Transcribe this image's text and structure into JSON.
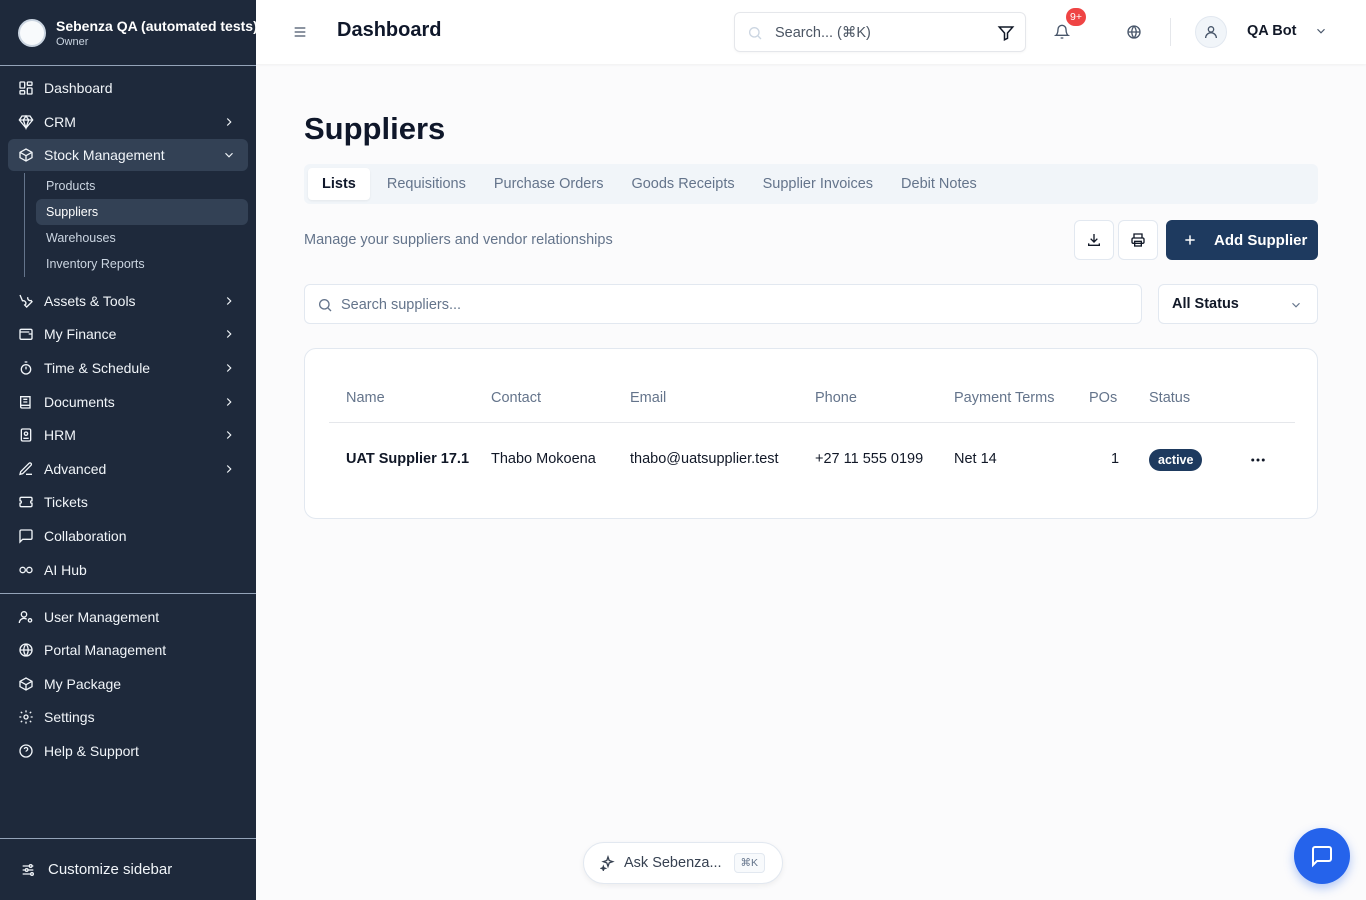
{
  "org": {
    "name": "Sebenza QA (automated tests)",
    "role": "Owner"
  },
  "sidebar": {
    "items": [
      {
        "label": "Dashboard",
        "icon": "layout-grid-icon"
      },
      {
        "label": "CRM",
        "icon": "gem-icon"
      },
      {
        "label": "Stock Management",
        "icon": "package-icon"
      },
      {
        "label": "Assets & Tools",
        "icon": "wrench-icon"
      },
      {
        "label": "My Finance",
        "icon": "wallet-icon"
      },
      {
        "label": "Time & Schedule",
        "icon": "timer-icon"
      },
      {
        "label": "Documents",
        "icon": "book-icon"
      },
      {
        "label": "HRM",
        "icon": "id-card-icon"
      },
      {
        "label": "Advanced",
        "icon": "pen-icon"
      },
      {
        "label": "Tickets",
        "icon": "ticket-icon"
      },
      {
        "label": "Collaboration",
        "icon": "message-square-icon"
      },
      {
        "label": "AI Hub",
        "icon": "link-icon"
      }
    ],
    "stock_sub": [
      "Products",
      "Suppliers",
      "Warehouses",
      "Inventory Reports"
    ],
    "bottom_items": [
      {
        "label": "User Management",
        "icon": "user-cog-icon"
      },
      {
        "label": "Portal Management",
        "icon": "globe-icon"
      },
      {
        "label": "My Package",
        "icon": "package-icon"
      },
      {
        "label": "Settings",
        "icon": "gear-icon"
      },
      {
        "label": "Help & Support",
        "icon": "help-circle-icon"
      }
    ],
    "footer": "Customize sidebar"
  },
  "header": {
    "title": "Dashboard",
    "search_placeholder": "Search... (⌘K)",
    "notification_count": "9+",
    "user_name": "QA Bot"
  },
  "page": {
    "title": "Suppliers",
    "tabs": [
      "Lists",
      "Requisitions",
      "Purchase Orders",
      "Goods Receipts",
      "Supplier Invoices",
      "Debit Notes"
    ],
    "subtitle": "Manage your suppliers and vendor relationships",
    "add_label": "Add Supplier",
    "search_placeholder": "Search suppliers...",
    "status_filter": "All Status"
  },
  "table": {
    "headers": [
      "Name",
      "Contact",
      "Email",
      "Phone",
      "Payment Terms",
      "POs",
      "Status"
    ],
    "rows": [
      {
        "name": "UAT Supplier 17.1",
        "contact": "Thabo Mokoena",
        "email": "thabo@uatsupplier.test",
        "phone": "+27 11 555 0199",
        "terms": "Net 14",
        "pos": "1",
        "status": "active"
      }
    ]
  },
  "assistant": {
    "label": "Ask Sebenza...",
    "shortcut": "⌘K"
  },
  "colors": {
    "sidebar_bg": "#1e293b",
    "primary": "#1e3a5f",
    "chat_fab": "#2563eb",
    "badge_red": "#ef4444"
  }
}
